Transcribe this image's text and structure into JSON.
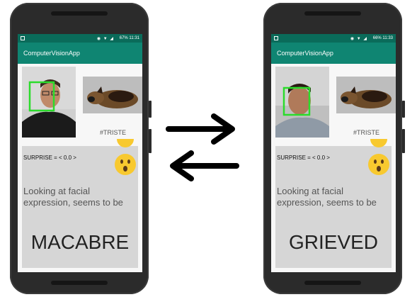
{
  "left_phone": {
    "status_time": "67% 11:31",
    "app_title": "ComputerVisionApp",
    "tag": "#TRISTE",
    "surprise_text": "SURPRISE = < 0.0 >",
    "looking_text": "Looking at facial expression, seems to be",
    "result": "MACABRE"
  },
  "right_phone": {
    "status_time": "66% 11:33",
    "app_title": "ComputerVisionApp",
    "tag": "#TRISTE",
    "surprise_text": "SURPRISE = < 0.0 >",
    "looking_text": "Looking at facial expression, seems to be",
    "result": "GRIEVED"
  },
  "icons": {
    "swap_arrows": "swap-arrows-icon",
    "emoji": "surprised-face-emoji",
    "face_box_color": "#2bdc2b"
  },
  "colors": {
    "status_bar": "#0a6b5a",
    "app_bar": "#0f8572",
    "panel": "#d6d6d6",
    "emoji_yellow": "#f8c92f"
  }
}
